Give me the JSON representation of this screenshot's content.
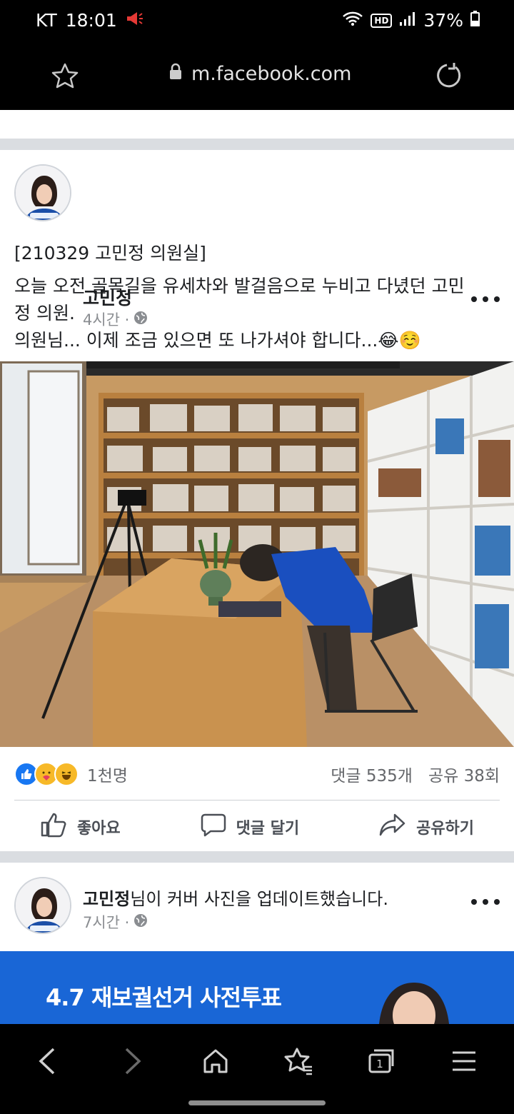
{
  "status_bar": {
    "carrier": "KT",
    "time": "18:01",
    "network_badge": "HD",
    "battery": "37%"
  },
  "browser": {
    "url": "m.facebook.com"
  },
  "post1": {
    "author": "고민정",
    "time": "4시간 · ",
    "text_line1": "[210329 고민정 의원실]",
    "text_line2": "오늘 오전 골목길을 유세차와 발걸음으로 누비고 다녔던 고민",
    "text_line3": "정 의원.",
    "text_line4": "의원님... 이제 조금 있으면 또 나가셔야 합니다...😂☺️",
    "reaction_count": "1천명",
    "comments": "댓글 535개",
    "shares": "공유 38회",
    "like_label": "좋아요",
    "comment_label": "댓글 달기",
    "share_label": "공유하기"
  },
  "post2": {
    "author": "고민정",
    "action": "님이 커버 사진을 업데이트했습니다.",
    "time": "7시간 · ",
    "cover_text": "4.7 재보궐선거 사전투표"
  },
  "colors": {
    "facebook_blue": "#1877f2",
    "cover_blue": "#1966d6",
    "text_secondary": "#65676b"
  }
}
